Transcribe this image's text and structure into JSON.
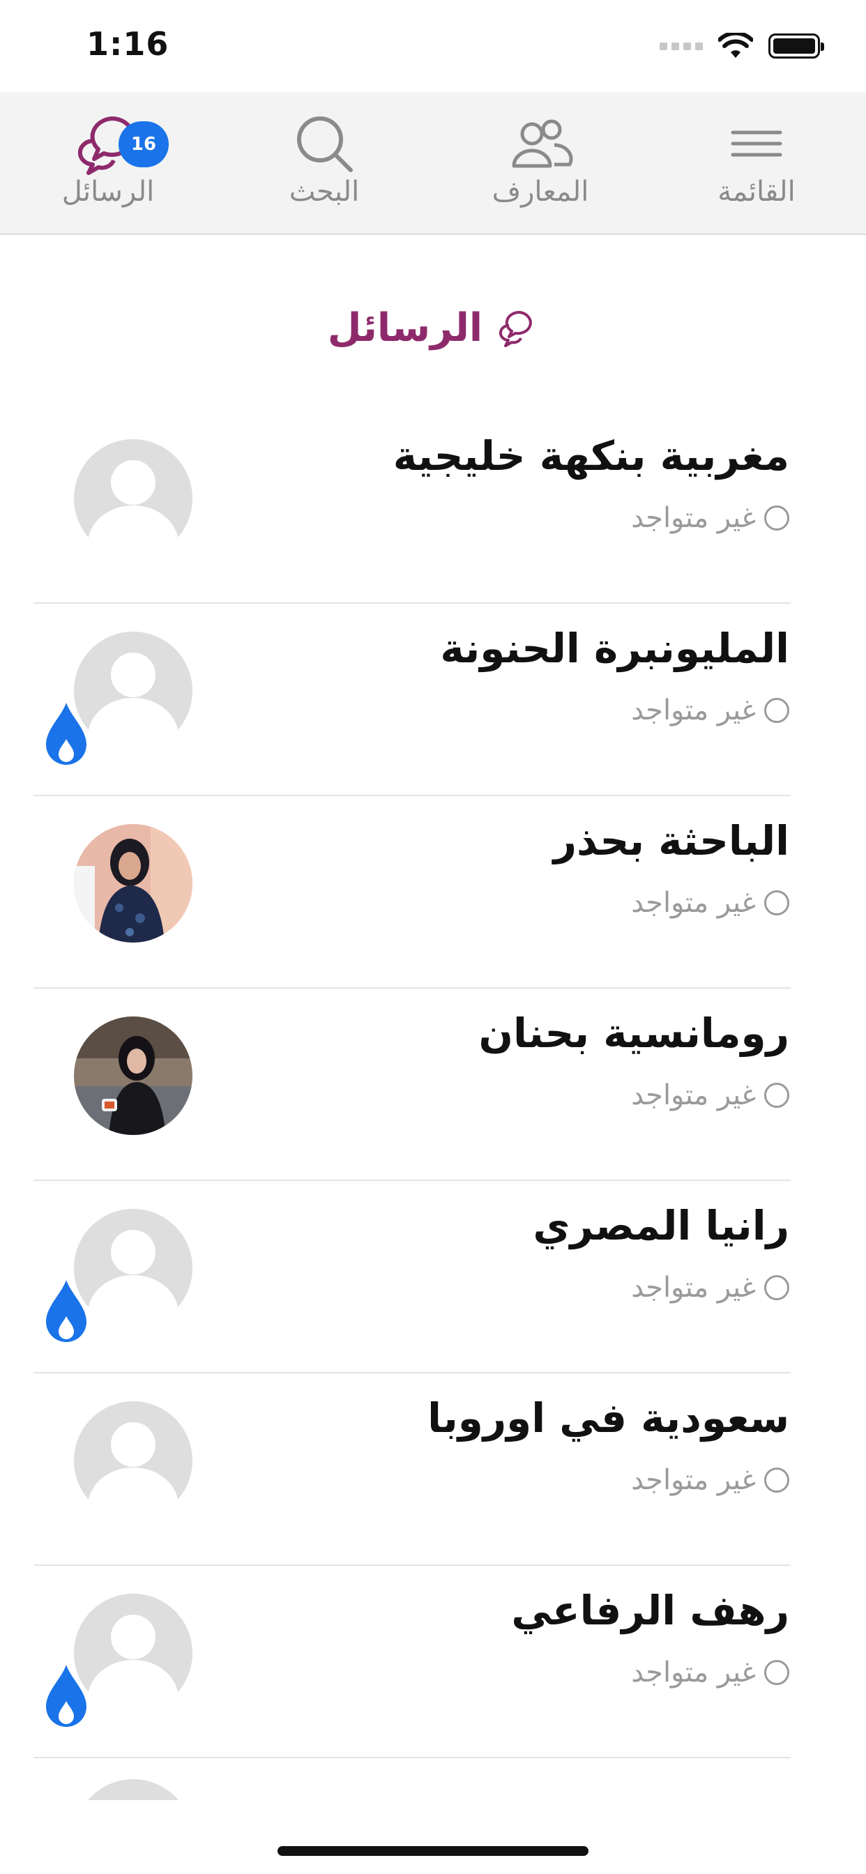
{
  "status_bar": {
    "time": "1:16"
  },
  "nav": {
    "menu_label": "القائمة",
    "contacts_label": "المعارف",
    "search_label": "البحث",
    "messages_label": "الرسائل",
    "messages_badge": "16",
    "accent_color": "#8e2a6b",
    "badge_color": "#1a73e8"
  },
  "page": {
    "title": "الرسائل"
  },
  "conversations": [
    {
      "name": "مغربية بنكهة خليجية",
      "status": "غير متواجد",
      "avatar": "placeholder",
      "flame": false
    },
    {
      "name": "المليونبرة الحنونة",
      "status": "غير متواجد",
      "avatar": "placeholder",
      "flame": true
    },
    {
      "name": "الباحثة بحذر",
      "status": "غير متواجد",
      "avatar": "photo",
      "flame": false
    },
    {
      "name": "رومانسية بحنان",
      "status": "غير متواجد",
      "avatar": "photo",
      "flame": false
    },
    {
      "name": "رانيا المصري",
      "status": "غير متواجد",
      "avatar": "placeholder",
      "flame": true
    },
    {
      "name": "سعودية في اوروبا",
      "status": "غير متواجد",
      "avatar": "placeholder",
      "flame": false
    },
    {
      "name": "رهف الرفاعي",
      "status": "غير متواجد",
      "avatar": "placeholder",
      "flame": true
    }
  ]
}
